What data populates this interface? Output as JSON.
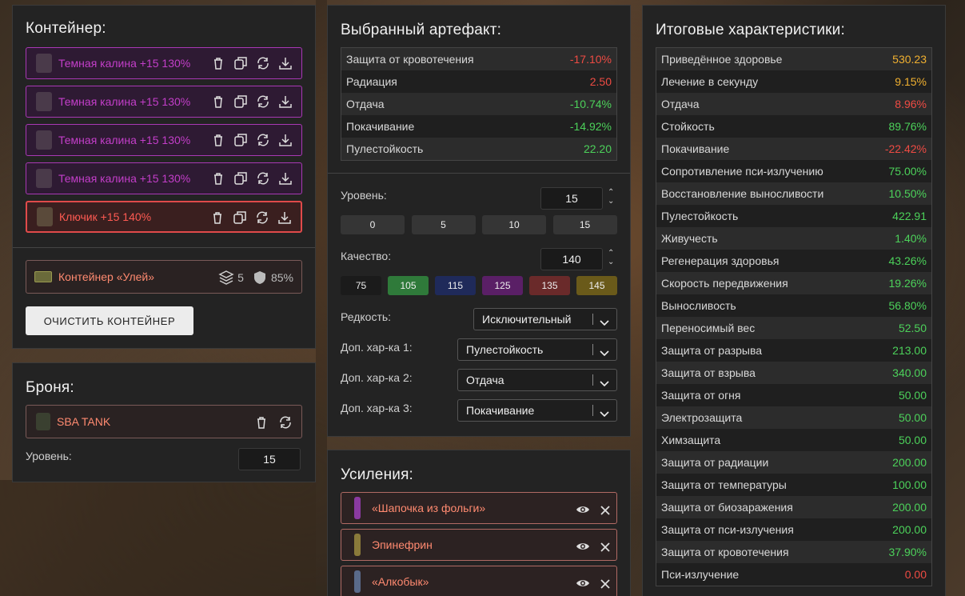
{
  "container": {
    "title": "Контейнер:",
    "slots": [
      {
        "label": "Темная калина +15 130%"
      },
      {
        "label": "Темная калина +15 130%"
      },
      {
        "label": "Темная калина +15 130%"
      },
      {
        "label": "Темная калина +15 130%"
      },
      {
        "label": "Ключик +15 140%"
      }
    ],
    "hive": {
      "label": "Контейнер «Улей»",
      "capacity": "5",
      "protection": "85%"
    },
    "clear_button": "ОЧИСТИТЬ КОНТЕЙНЕР"
  },
  "armor": {
    "title": "Броня:",
    "name": "SBA TANK",
    "level_label": "Уровень:",
    "level_value": "15"
  },
  "artifact": {
    "title": "Выбранный артефакт:",
    "stats": [
      {
        "name": "Защита от кровотечения",
        "value": "-17.10%",
        "tone": "neg"
      },
      {
        "name": "Радиация",
        "value": "2.50",
        "tone": "neg"
      },
      {
        "name": "Отдача",
        "value": "-10.74%",
        "tone": "pos"
      },
      {
        "name": "Покачивание",
        "value": "-14.92%",
        "tone": "pos"
      },
      {
        "name": "Пулестойкость",
        "value": "22.20",
        "tone": "pos"
      }
    ],
    "level_label": "Уровень:",
    "level_value": "15",
    "level_presets": [
      "0",
      "5",
      "10",
      "15"
    ],
    "quality_label": "Качество:",
    "quality_value": "140",
    "quality_presets": [
      {
        "label": "75",
        "color": "#1b1b1b"
      },
      {
        "label": "105",
        "color": "#2f7a3a"
      },
      {
        "label": "115",
        "color": "#1f2a5a"
      },
      {
        "label": "125",
        "color": "#5a1f66"
      },
      {
        "label": "135",
        "color": "#6a2a2a"
      },
      {
        "label": "145",
        "color": "#6a5a1a"
      }
    ],
    "rarity_label": "Редкость:",
    "rarity_value": "Исключительный",
    "extra1_label": "Доп. хар-ка 1:",
    "extra1_value": "Пулестойкость",
    "extra2_label": "Доп. хар-ка 2:",
    "extra2_value": "Отдача",
    "extra3_label": "Доп. хар-ка 3:",
    "extra3_value": "Покачивание"
  },
  "boosts": {
    "title": "Усиления:",
    "items": [
      {
        "label": "«Шапочка из фольги»"
      },
      {
        "label": "Эпинефрин"
      },
      {
        "label": "«Алкобык»"
      }
    ]
  },
  "totals": {
    "title": "Итоговые характеристики:",
    "rows": [
      {
        "name": "Приведённое здоровье",
        "value": "530.23",
        "tone": "warn"
      },
      {
        "name": "Лечение в секунду",
        "value": "9.15%",
        "tone": "warn"
      },
      {
        "name": "Отдача",
        "value": "8.96%",
        "tone": "neg"
      },
      {
        "name": "Стойкость",
        "value": "89.76%",
        "tone": "pos"
      },
      {
        "name": "Покачивание",
        "value": "-22.42%",
        "tone": "neg"
      },
      {
        "name": "Сопротивление пси-излучению",
        "value": "75.00%",
        "tone": "pos"
      },
      {
        "name": "Восстановление выносливости",
        "value": "10.50%",
        "tone": "pos"
      },
      {
        "name": "Пулестойкость",
        "value": "422.91",
        "tone": "pos"
      },
      {
        "name": "Живучесть",
        "value": "1.40%",
        "tone": "pos"
      },
      {
        "name": "Регенерация здоровья",
        "value": "43.26%",
        "tone": "pos"
      },
      {
        "name": "Скорость передвижения",
        "value": "19.26%",
        "tone": "pos"
      },
      {
        "name": "Выносливость",
        "value": "56.80%",
        "tone": "pos"
      },
      {
        "name": "Переносимый вес",
        "value": "52.50",
        "tone": "pos"
      },
      {
        "name": "Защита от разрыва",
        "value": "213.00",
        "tone": "pos"
      },
      {
        "name": "Защита от взрыва",
        "value": "340.00",
        "tone": "pos"
      },
      {
        "name": "Защита от огня",
        "value": "50.00",
        "tone": "pos"
      },
      {
        "name": "Электрозащита",
        "value": "50.00",
        "tone": "pos"
      },
      {
        "name": "Химзащита",
        "value": "50.00",
        "tone": "pos"
      },
      {
        "name": "Защита от радиации",
        "value": "200.00",
        "tone": "pos"
      },
      {
        "name": "Защита от температуры",
        "value": "100.00",
        "tone": "pos"
      },
      {
        "name": "Защита от биозаражения",
        "value": "200.00",
        "tone": "pos"
      },
      {
        "name": "Защита от пси-излучения",
        "value": "200.00",
        "tone": "pos"
      },
      {
        "name": "Защита от кровотечения",
        "value": "37.90%",
        "tone": "pos"
      },
      {
        "name": "Пси-излучение",
        "value": "0.00",
        "tone": "neg"
      }
    ]
  },
  "colors": {
    "panel": "#232323",
    "positive": "#4cd15a",
    "negative": "#ee4b43",
    "warning": "#f0b030",
    "slot_border": "#a838b4",
    "slot_text": "#c33ec9"
  }
}
